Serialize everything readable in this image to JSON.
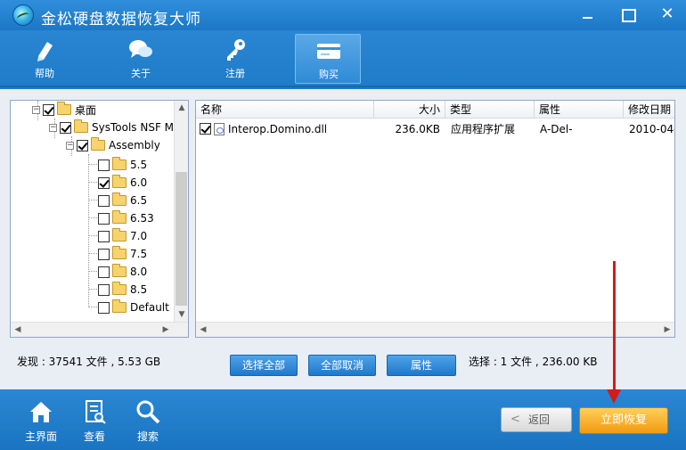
{
  "app": {
    "title": "金松硬盘数据恢复大师"
  },
  "toolbar": {
    "items": [
      {
        "label": "帮助",
        "icon": "pen-icon"
      },
      {
        "label": "关于",
        "icon": "chat-icon"
      },
      {
        "label": "注册",
        "icon": "key-icon"
      },
      {
        "label": "购买",
        "icon": "card-icon"
      }
    ]
  },
  "tree": {
    "items": [
      {
        "label": "桌面",
        "checked": true
      },
      {
        "label": "SysTools NSF M",
        "checked": true
      },
      {
        "label": "Assembly",
        "checked": true
      },
      {
        "label": "5.5",
        "checked": false
      },
      {
        "label": "6.0",
        "checked": true
      },
      {
        "label": "6.5",
        "checked": false
      },
      {
        "label": "6.53",
        "checked": false
      },
      {
        "label": "7.0",
        "checked": false
      },
      {
        "label": "7.5",
        "checked": false
      },
      {
        "label": "8.0",
        "checked": false
      },
      {
        "label": "8.5",
        "checked": false
      },
      {
        "label": "Default",
        "checked": false
      }
    ]
  },
  "list": {
    "columns": [
      "名称",
      "大小",
      "类型",
      "属性",
      "修改日期"
    ],
    "rows": [
      {
        "name": "Interop.Domino.dll",
        "size": "236.0KB",
        "type": "应用程序扩展",
        "attr": "A-Del-",
        "date": "2010-04-",
        "checked": true
      }
    ]
  },
  "status": {
    "found": "发现 : 37541 文件 , 5.53 GB",
    "selected": "选择 : 1 文件 , 236.00 KB"
  },
  "actions": {
    "select_all": "选择全部",
    "deselect_all": "全部取消",
    "properties": "属性"
  },
  "footer": {
    "items": [
      {
        "label": "主界面",
        "icon": "home-icon"
      },
      {
        "label": "查看",
        "icon": "document-icon"
      },
      {
        "label": "搜索",
        "icon": "search-icon"
      }
    ],
    "back_label": "返回",
    "recover_label": "立即恢复"
  },
  "colors": {
    "accent": "#1f7cc8",
    "recover": "#f29a10",
    "annotation_arrow": "#d41a1a"
  }
}
